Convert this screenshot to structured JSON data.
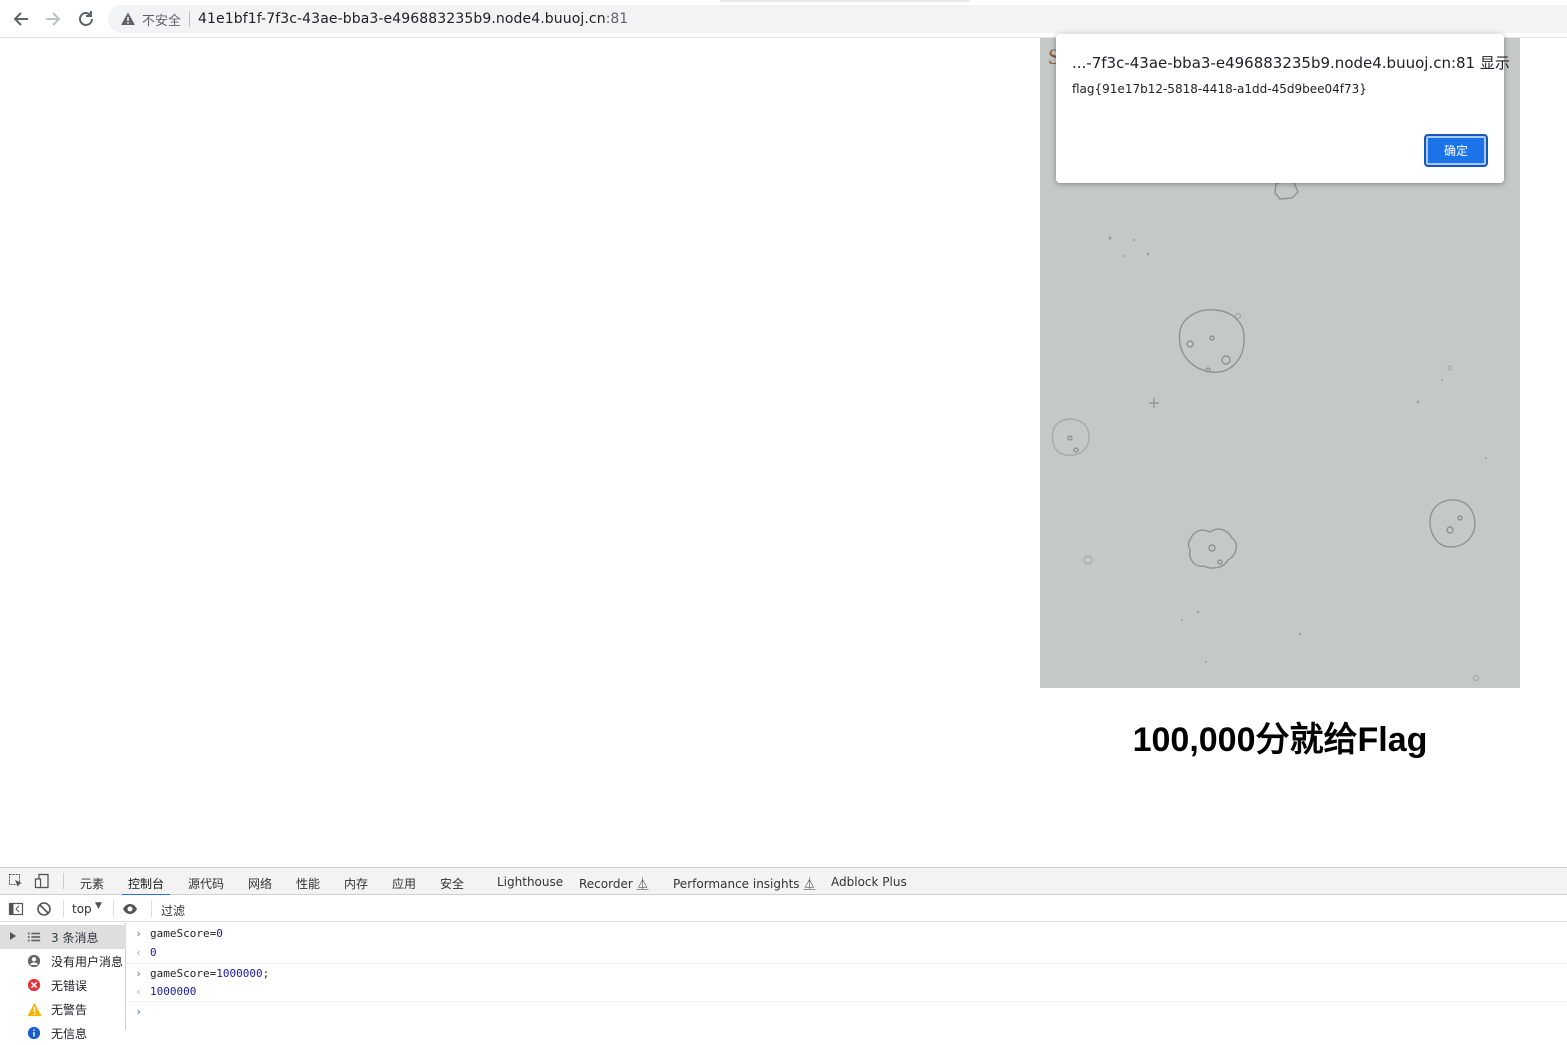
{
  "browser": {
    "security_label": "不安全",
    "url_host": "41e1bf1f-7f3c-43ae-bba3-e496883235b9.node4.buuoj.cn",
    "url_port": ":81",
    "icons": [
      "back-arrow-icon",
      "forward-arrow-icon",
      "reload-icon",
      "warning-triangle-icon"
    ]
  },
  "page": {
    "game_title_fragment": "S",
    "score_prompt": "100,000分就给Flag"
  },
  "alert": {
    "title": "...-7f3c-43ae-bba3-e496883235b9.node4.buuoj.cn:81 显示",
    "message": "flag{91e17b12-5818-4418-a1dd-45d9bee04f73}",
    "ok_label": "确定"
  },
  "devtools": {
    "tabs": [
      {
        "label": "元素"
      },
      {
        "label": "控制台",
        "active": true
      },
      {
        "label": "源代码"
      },
      {
        "label": "网络"
      },
      {
        "label": "性能"
      },
      {
        "label": "内存"
      },
      {
        "label": "应用"
      },
      {
        "label": "安全"
      },
      {
        "label": "Lighthouse"
      },
      {
        "label": "Recorder ⏅"
      },
      {
        "label": "Performance insights ⏅"
      },
      {
        "label": "Adblock Plus"
      }
    ],
    "context": "top",
    "filter_placeholder": "过滤",
    "sidebar": [
      {
        "label": "3 条消息",
        "icon": "list-icon"
      },
      {
        "label": "没有用户消息",
        "icon": "user-icon"
      },
      {
        "label": "无错误",
        "icon": "error-icon"
      },
      {
        "label": "无警告",
        "icon": "warning-icon"
      },
      {
        "label": "无信息",
        "icon": "info-icon"
      }
    ],
    "console": [
      {
        "type": "input",
        "code": "gameScore=",
        "value": "0",
        "tail": ""
      },
      {
        "type": "output",
        "value": "0"
      },
      {
        "type": "input",
        "code": "gameScore=",
        "value": "1000000",
        "tail": ";"
      },
      {
        "type": "output",
        "value": "1000000"
      }
    ],
    "colors": {
      "accent": "#1a73e8",
      "number": "#1a1aa6"
    }
  }
}
